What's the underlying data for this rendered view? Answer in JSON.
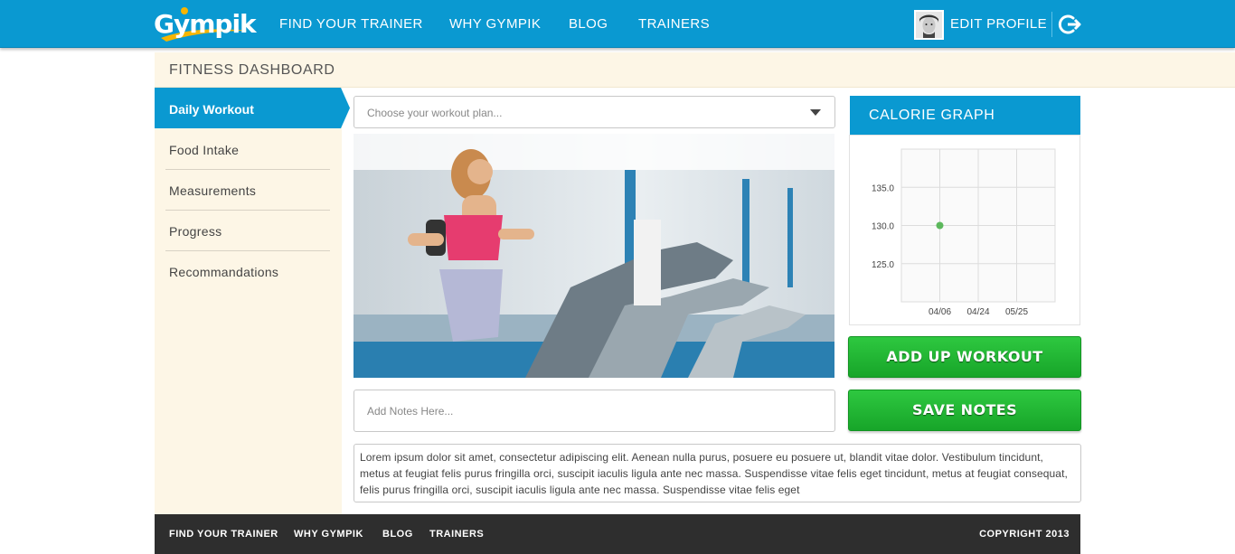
{
  "brand": {
    "logo_text": "Gympik"
  },
  "nav": {
    "items": [
      "FIND YOUR TRAINER",
      "WHY GYMPIK",
      "BLOG",
      "TRAINERS"
    ],
    "edit_profile": "EDIT PROFILE"
  },
  "page": {
    "title": "FITNESS DASHBOARD"
  },
  "sidebar": {
    "active": "Daily Workout",
    "items": [
      "Food Intake",
      "Measurements",
      "Progress",
      "Recommandations"
    ]
  },
  "workout": {
    "select_placeholder": "Choose your workout plan...",
    "notes_placeholder": "Add Notes Here...",
    "notes_text": "Lorem ipsum dolor sit amet, consectetur adipiscing elit. Aenean nulla purus, posuere eu posuere ut, blandit vitae dolor. Vestibulum tincidunt, metus at feugiat felis purus fringilla orci, suscipit iaculis ligula ante nec massa. Suspendisse vitae felis eget tincidunt, metus at feugiat consequat, felis purus fringilla orci, suscipit iaculis ligula ante nec massa. Suspendisse vitae felis eget"
  },
  "calorie_panel": {
    "title": "CALORIE GRAPH"
  },
  "chart_data": {
    "type": "scatter",
    "title": "",
    "x_ticks": [
      "04/06",
      "04/24",
      "05/25"
    ],
    "y_ticks": [
      135.0,
      130.0,
      125.0
    ],
    "ylim": [
      120,
      140
    ],
    "grid": true,
    "points": [
      {
        "x": "04/06",
        "y": 130.0
      }
    ],
    "point_color": "#5cb85c"
  },
  "buttons": {
    "add_workout": "ADD UP WORKOUT",
    "save_notes": "SAVE NOTES"
  },
  "footer": {
    "links": [
      "FIND YOUR TRAINER",
      "WHY GYMPIK",
      "BLOG",
      "TRAINERS"
    ],
    "copyright": "COPYRIGHT 2013"
  },
  "colors": {
    "primary": "#0a99d1",
    "accent_green": "#1fb532",
    "panel_bg": "#fdf6e6",
    "footer_bg": "#2e2e2e"
  }
}
